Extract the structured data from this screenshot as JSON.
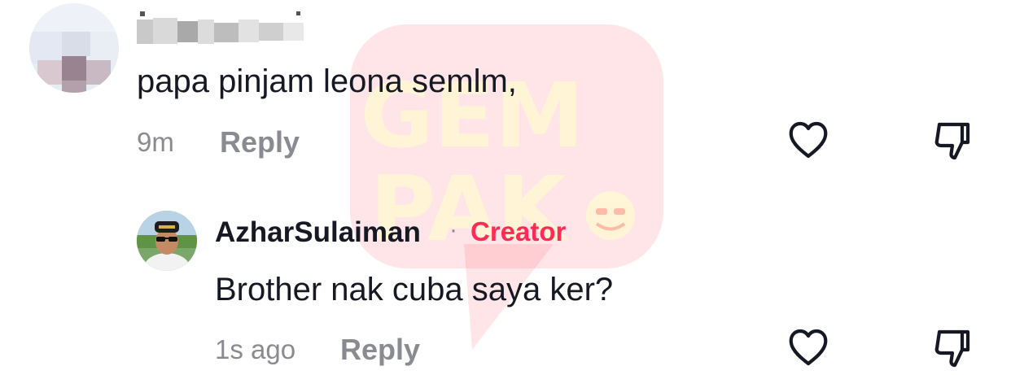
{
  "watermark": {
    "logo_text_line1": "GEM",
    "logo_text_line2": "PAK",
    "color": "#fe2c3a",
    "text_color": "#fff6d6"
  },
  "comments": [
    {
      "username": "████ ████",
      "text": "papa pinjam leona semlm,",
      "time": "9m",
      "reply_label": "Reply",
      "like_icon": "heart-outline-icon",
      "dislike_icon": "thumbs-down-outline-icon"
    }
  ],
  "reply": {
    "username": "AzharSulaiman",
    "separator": "·",
    "badge": "Creator",
    "badge_color": "#fe2c55",
    "text": "Brother nak cuba saya ker?",
    "time": "1s ago",
    "reply_label": "Reply",
    "like_icon": "heart-outline-icon",
    "dislike_icon": "thumbs-down-outline-icon"
  },
  "colors": {
    "primary_text": "#161823",
    "secondary_text": "#8a8b91",
    "accent": "#fe2c55"
  }
}
